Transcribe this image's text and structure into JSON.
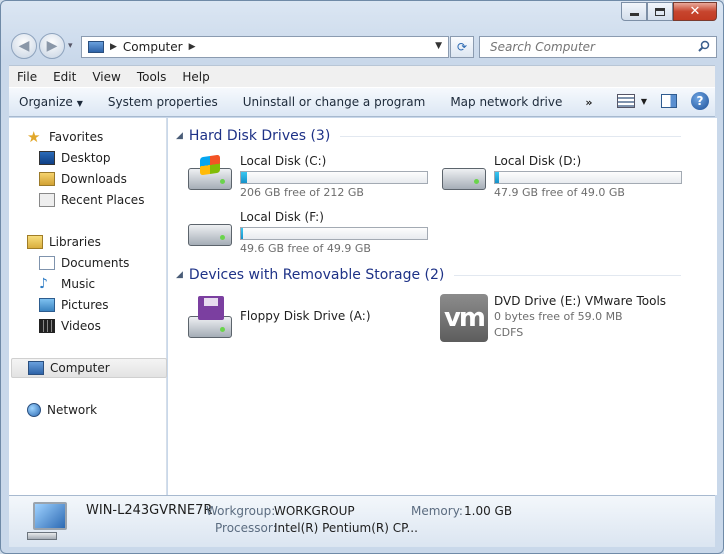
{
  "window": {
    "min_glyph": "",
    "close_glyph": "✕"
  },
  "nav": {
    "address_segments": [
      "Computer"
    ],
    "search_placeholder": "Search Computer"
  },
  "menu": [
    "File",
    "Edit",
    "View",
    "Tools",
    "Help"
  ],
  "commands": {
    "organize": "Organize",
    "system_properties": "System properties",
    "uninstall": "Uninstall or change a program",
    "map_drive": "Map network drive",
    "more": "»",
    "help": "?"
  },
  "sidebar": {
    "favorites": "Favorites",
    "favorites_items": [
      "Desktop",
      "Downloads",
      "Recent Places"
    ],
    "libraries": "Libraries",
    "library_items": [
      "Documents",
      "Music",
      "Pictures",
      "Videos"
    ],
    "computer": "Computer",
    "network": "Network"
  },
  "groups": {
    "hdd_title": "Hard Disk Drives (3)",
    "removable_title": "Devices with Removable Storage (2)"
  },
  "drives": [
    {
      "name": "Local Disk (C:)",
      "free": "206 GB free of 212 GB",
      "used_fraction": 0.03
    },
    {
      "name": "Local Disk (D:)",
      "free": "47.9 GB free of 49.0 GB",
      "used_fraction": 0.02
    },
    {
      "name": "Local Disk (F:)",
      "free": "49.6 GB free of 49.9 GB",
      "used_fraction": 0.006
    }
  ],
  "removable": [
    {
      "name": "Floppy Disk Drive (A:)"
    },
    {
      "name": "DVD Drive (E:) VMware Tools",
      "free": "0 bytes free of 59.0 MB",
      "fs": "CDFS",
      "logo": "vm"
    }
  ],
  "details": {
    "computer_name": "WIN-L243GVRNE7R",
    "workgroup_label": "Workgroup:",
    "workgroup": "WORKGROUP",
    "memory_label": "Memory:",
    "memory": "1.00 GB",
    "processor_label": "Processor:",
    "processor": "Intel(R) Pentium(R) CP..."
  },
  "colors": {
    "group_title": "#1e3287",
    "bar_fill": "#1691c8",
    "close_button": "#c7452e"
  }
}
